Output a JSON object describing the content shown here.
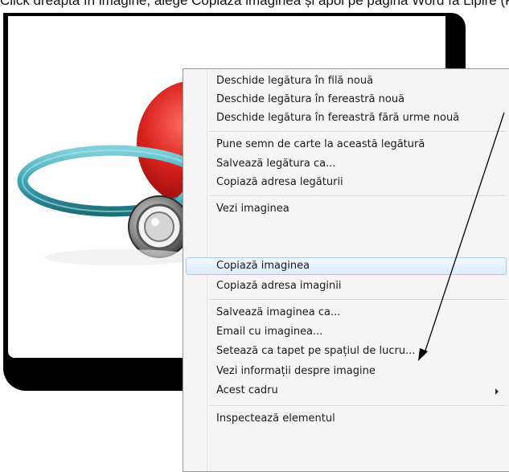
{
  "instruction_text": "Click dreapta în imagine, alege Copiază imaginea și apoi pe pagina Word fă Lipire (Paste)",
  "photo": {
    "subject": "stethoscope-with-red-heart",
    "colors": {
      "tube": "#3fa6b4",
      "heart": "#d8211c",
      "chest_piece": "#8a8a8a"
    }
  },
  "context_menu": {
    "items": [
      {
        "label": "Deschide legătura în filă nouă"
      },
      {
        "label": "Deschide legătura în fereastră nouă"
      },
      {
        "label": "Deschide legătura în fereastră fără urme nouă"
      },
      {
        "label": "Pune semn de carte la această legătură"
      },
      {
        "label": "Salvează legătura ca..."
      },
      {
        "label": "Copiază adresa legăturii"
      },
      {
        "label": "Vezi imaginea"
      },
      {
        "label": "Copiază imaginea",
        "highlighted": true
      },
      {
        "label": "Copiază adresa imaginii"
      },
      {
        "label": "Salvează imaginea ca..."
      },
      {
        "label": "Email cu imaginea..."
      },
      {
        "label": "Setează ca tapet pe spațiul de lucru..."
      },
      {
        "label": "Vezi informații despre imagine"
      },
      {
        "label": "Acest cadru",
        "has_submenu": true
      },
      {
        "label": "Inspectează elementul"
      }
    ],
    "colors": {
      "highlight_border": "#a8cbef",
      "background": "#f5f5f5"
    }
  }
}
